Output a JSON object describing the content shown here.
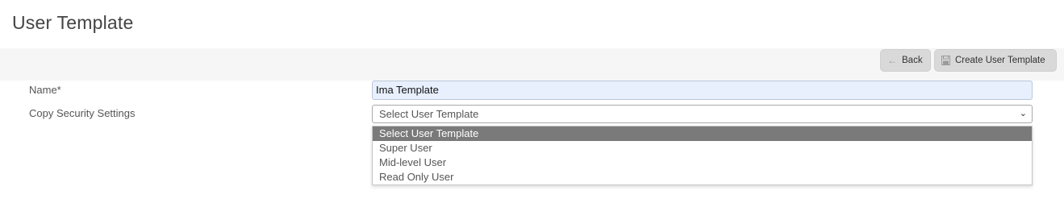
{
  "page": {
    "title": "User Template"
  },
  "toolbar": {
    "back_label": "Back",
    "create_label": "Create User Template"
  },
  "form": {
    "name_label": "Name*",
    "name_value": "Ima Template",
    "copy_label": "Copy Security Settings",
    "copy_selected": "Select User Template",
    "copy_options": [
      "Select User Template",
      "Super User",
      "Mid-level User",
      "Read Only User"
    ]
  },
  "colors": {
    "toolbar_bg": "#f6f6f6",
    "button_bg": "#d9d9d9",
    "input_autofill_bg": "#e8f0fe",
    "option_selected_bg": "#7a7a7a"
  },
  "icons": {
    "back": "arrow-left-icon",
    "create": "save-disk-icon",
    "select": "chevron-down-icon"
  }
}
